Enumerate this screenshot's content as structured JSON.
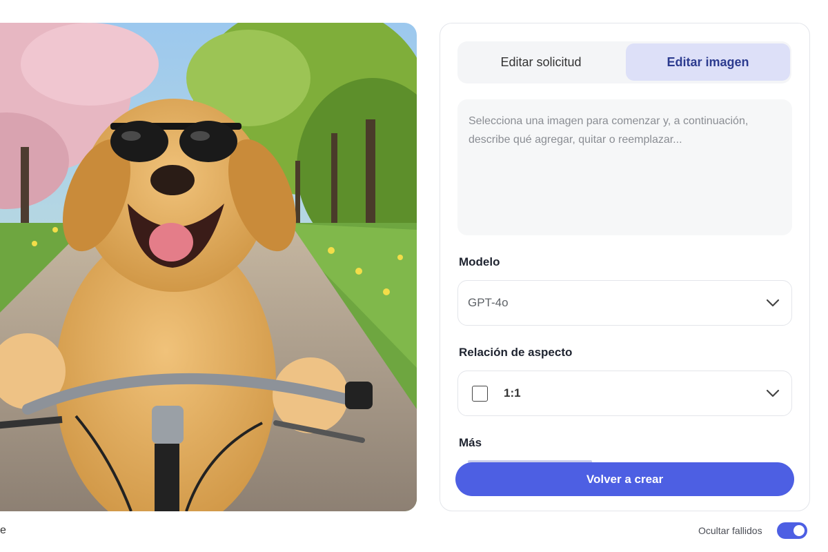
{
  "preview": {
    "alt": "dog-on-bicycle-image"
  },
  "tabs": [
    {
      "label": "Editar solicitud",
      "active": false
    },
    {
      "label": "Editar imagen",
      "active": true
    }
  ],
  "prompt": {
    "value": "",
    "placeholder": "Selecciona una imagen para comenzar y, a continuación, describe qué agregar, quitar o reemplazar..."
  },
  "model": {
    "label": "Modelo",
    "value": "GPT-4o"
  },
  "aspect": {
    "label": "Relación de aspecto",
    "value": "1:1"
  },
  "more": {
    "label": "Más"
  },
  "actions": {
    "recreate_label": "Volver a crear"
  },
  "footer": {
    "left_text": "e",
    "toggle_label": "Ocultar fallidos",
    "toggle_on": true
  },
  "colors": {
    "accent": "#4d5fe3",
    "tab_active_bg": "#dde0f8",
    "tab_active_text": "#2c3b8f"
  }
}
